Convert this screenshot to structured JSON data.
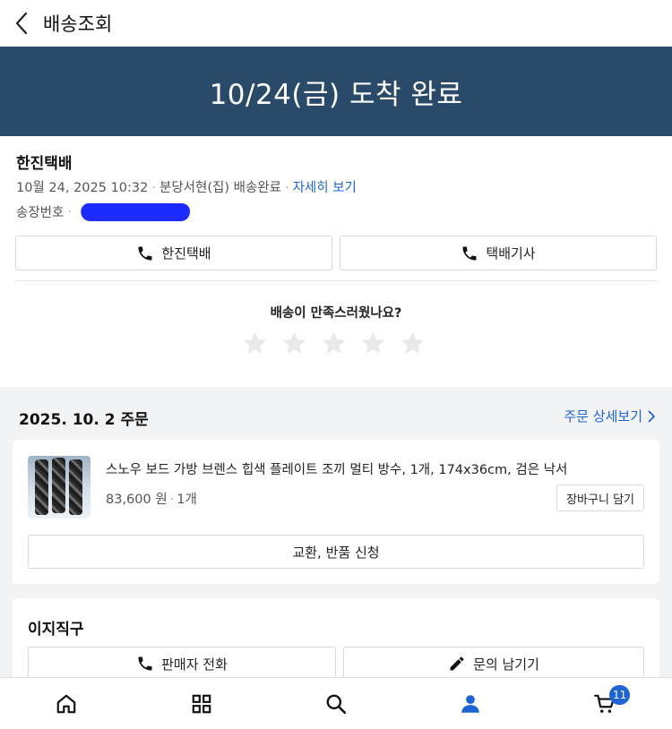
{
  "header": {
    "title": "배송조회"
  },
  "banner": {
    "status": "10/24(금) 도착 완료"
  },
  "shipment": {
    "carrier": "한진택배",
    "datetime": "10월 24, 2025 10:32",
    "location": "분당서현(집) 배송완료",
    "detail_link": "자세히 보기",
    "tracking_label": "송장번호",
    "call_carrier": "한진택배",
    "call_driver": "택배기사"
  },
  "rating": {
    "question": "배송이 만족스러웠나요?",
    "stars": 5
  },
  "order": {
    "date": "2025. 10. 2 주문",
    "detail_link": "주문 상세보기",
    "item": {
      "name": "스노우 보드 가방 브렌스 힙색 플레이트 조끼 멀티 방수, 1개, 174x36cm, 검은 낙서",
      "price": "83,600 원",
      "qty": "1개",
      "cart_button": "장바구니 담기",
      "exchange_button": "교환, 반품 신청"
    }
  },
  "seller": {
    "name": "이지직구",
    "call_button": "판매자 전화",
    "inquiry_button": "문의 남기기"
  },
  "nav": {
    "items": [
      "home-icon",
      "grid-icon",
      "search-icon",
      "user-icon",
      "cart-icon"
    ],
    "cart_badge": "11",
    "active": "user-icon"
  },
  "colors": {
    "banner": "#2a4a6a",
    "link": "#1d64d6",
    "redaction": "#1c2cff"
  }
}
